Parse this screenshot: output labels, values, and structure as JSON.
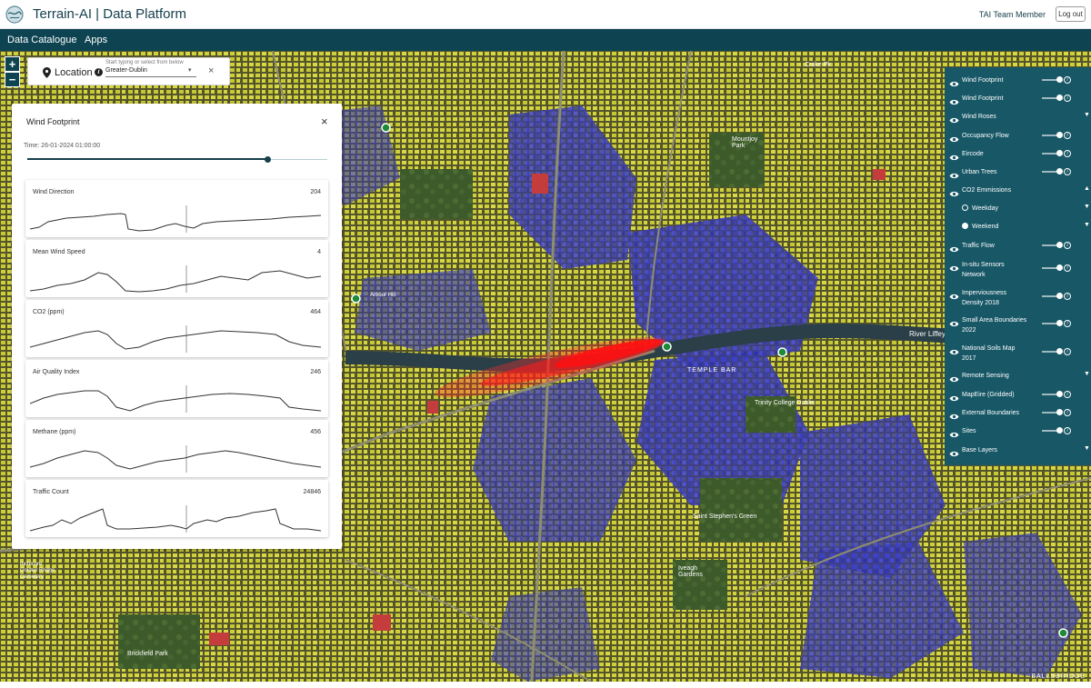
{
  "header": {
    "title": "Terrain-AI | Data Platform",
    "user": "TAI Team Member",
    "logout_label": "Log out"
  },
  "nav": {
    "items": [
      "Data Catalogue",
      "Apps"
    ]
  },
  "map_controls": {
    "zoom_in": "+",
    "zoom_out": "−"
  },
  "location": {
    "label": "Location",
    "hint": "Start typing or select from below",
    "value": "Greater-Dublin",
    "info_glyph": "i",
    "close_glyph": "×",
    "caret_glyph": "▾"
  },
  "wind_panel": {
    "title": "Wind Footprint",
    "close_glyph": "×",
    "time_label": "Time: 26-01-2024 01:00:00",
    "slider_position": 0.8,
    "metrics": [
      {
        "name": "Wind Direction",
        "value": "204"
      },
      {
        "name": "Mean Wind Speed",
        "value": "4"
      },
      {
        "name": "CO2 (ppm)",
        "value": "464"
      },
      {
        "name": "Air Quality Index",
        "value": "246"
      },
      {
        "name": "Methane (ppm)",
        "value": "456"
      },
      {
        "name": "Traffic Count",
        "value": "24846"
      }
    ]
  },
  "layers": {
    "items": [
      {
        "label": "Wind Footprint",
        "eye": true,
        "toggle": true,
        "info": true
      },
      {
        "label": "Wind Footprint",
        "eye": true,
        "toggle": true,
        "info": true
      },
      {
        "label": "Wind Roses",
        "eye": true,
        "arrow": "▼"
      },
      {
        "label": "Occupancy Flow",
        "eye": true,
        "toggle": true,
        "info": true
      },
      {
        "label": "Eircode",
        "eye": true,
        "toggle": true,
        "info": true
      },
      {
        "label": "Urban Trees",
        "eye": true,
        "toggle": true,
        "info": true
      },
      {
        "label": "CO2 Emmissions",
        "eye": true,
        "arrow": "▲"
      },
      {
        "label": "Weekday",
        "radio": false,
        "arrow": "▼"
      },
      {
        "label": "Weekend",
        "radio": true,
        "arrow": "▼"
      },
      {
        "label": "Traffic Flow",
        "eye": true,
        "toggle": true,
        "info": true
      },
      {
        "label": "In-situ Sensors",
        "label2": "Network",
        "eye": true,
        "toggle": true,
        "info": true
      },
      {
        "label": "Imperviousness",
        "label2": "Density 2018",
        "eye": true,
        "toggle": true,
        "info": true
      },
      {
        "label": "Small Area Boundaries",
        "label2": "2022",
        "eye": true,
        "toggle": true,
        "info": true
      },
      {
        "label": "National Soils Map",
        "label2": "2017",
        "eye": true,
        "toggle": true,
        "info": true
      },
      {
        "label": "Remote Sensing",
        "eye": true,
        "arrow": "▼"
      },
      {
        "label": "MapEire (Gridded)",
        "eye": true,
        "toggle": true,
        "info": true
      },
      {
        "label": "External Boundaries",
        "eye": true,
        "toggle": true,
        "info": true
      },
      {
        "label": "Sites",
        "eye": true,
        "toggle": true,
        "info": true
      },
      {
        "label": "Base Layers",
        "eye": true,
        "arrow": "▼"
      }
    ]
  },
  "map_labels": {
    "temple_bar": "TEMPLE BAR",
    "trinity": "Trinity College Dublin",
    "stephens_green": "Saint Stephen's Green",
    "river": "River Liffey",
    "brickfield": "Brickfield Park",
    "croke": "Croke Pk",
    "iveagh": "Iveagh Gardens",
    "mountjoy": "Mountjoy Park",
    "arbour": "Arbour Hill",
    "cemetery": "Inchicore Golden Bridge Cemetery",
    "attribution": "BALLSBRIDGE"
  },
  "colors": {
    "brand": "#0e4452",
    "panel": "#175766",
    "plume": "#ff1a1a"
  }
}
